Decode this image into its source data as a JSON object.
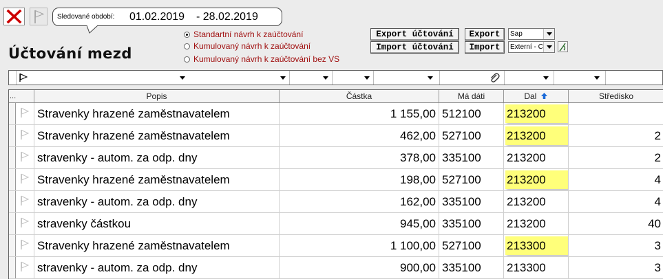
{
  "period": {
    "label": "Sledované období:",
    "from": "01.02.2019",
    "to": "- 28.02.2019"
  },
  "page": {
    "title": "Účtování mezd"
  },
  "options": [
    {
      "label": "Standartní návrh k zaúčtování",
      "selected": true
    },
    {
      "label": "Kumulovaný návrh k zaúčtování",
      "selected": false
    },
    {
      "label": "Kumulovaný návrh k zaúčtování bez VS",
      "selected": false
    }
  ],
  "toolbar": {
    "export_accounting": "Export účtování",
    "import_accounting": "Import účtování",
    "export": "Export",
    "import": "Import",
    "export_format": "Sap",
    "import_source": "Externí - C"
  },
  "icons": {
    "close": "close-icon",
    "flag": "flag-icon",
    "attachment": "paperclip-icon",
    "sort": "sort-ascending-icon",
    "edit": "edit-icon"
  },
  "colors": {
    "close": "#cc0000",
    "highlight": "#ffff7a",
    "option_text": "#a01010",
    "sort_arrow": "#1a6ad8"
  },
  "table": {
    "selector_header": "...",
    "columns": [
      "Popis",
      "Částka",
      "Má dáti",
      "Dal",
      "Středisko"
    ],
    "sorted_column": "Dal",
    "rows": [
      {
        "popis": "Stravenky hrazené zaměstnavatelem",
        "castka": "1 155,00",
        "ma_dati": "512100",
        "dal": "213200",
        "stredisko": "",
        "highlight": true
      },
      {
        "popis": "Stravenky hrazené zaměstnavatelem",
        "castka": "462,00",
        "ma_dati": "527100",
        "dal": "213200",
        "stredisko": "2",
        "highlight": true
      },
      {
        "popis": "stravenky - autom. za odp. dny",
        "castka": "378,00",
        "ma_dati": "335100",
        "dal": "213200",
        "stredisko": "2",
        "highlight": false
      },
      {
        "popis": "Stravenky hrazené zaměstnavatelem",
        "castka": "198,00",
        "ma_dati": "527100",
        "dal": "213200",
        "stredisko": "4",
        "highlight": true
      },
      {
        "popis": "stravenky - autom. za odp. dny",
        "castka": "162,00",
        "ma_dati": "335100",
        "dal": "213200",
        "stredisko": "4",
        "highlight": false
      },
      {
        "popis": "stravenky částkou",
        "castka": "945,00",
        "ma_dati": "335100",
        "dal": "213200",
        "stredisko": "40",
        "highlight": false
      },
      {
        "popis": "Stravenky hrazené zaměstnavatelem",
        "castka": "1 100,00",
        "ma_dati": "527100",
        "dal": "213300",
        "stredisko": "3",
        "highlight": true
      },
      {
        "popis": "stravenky - autom. za odp. dny",
        "castka": "900,00",
        "ma_dati": "335100",
        "dal": "213300",
        "stredisko": "3",
        "highlight": false
      }
    ]
  }
}
